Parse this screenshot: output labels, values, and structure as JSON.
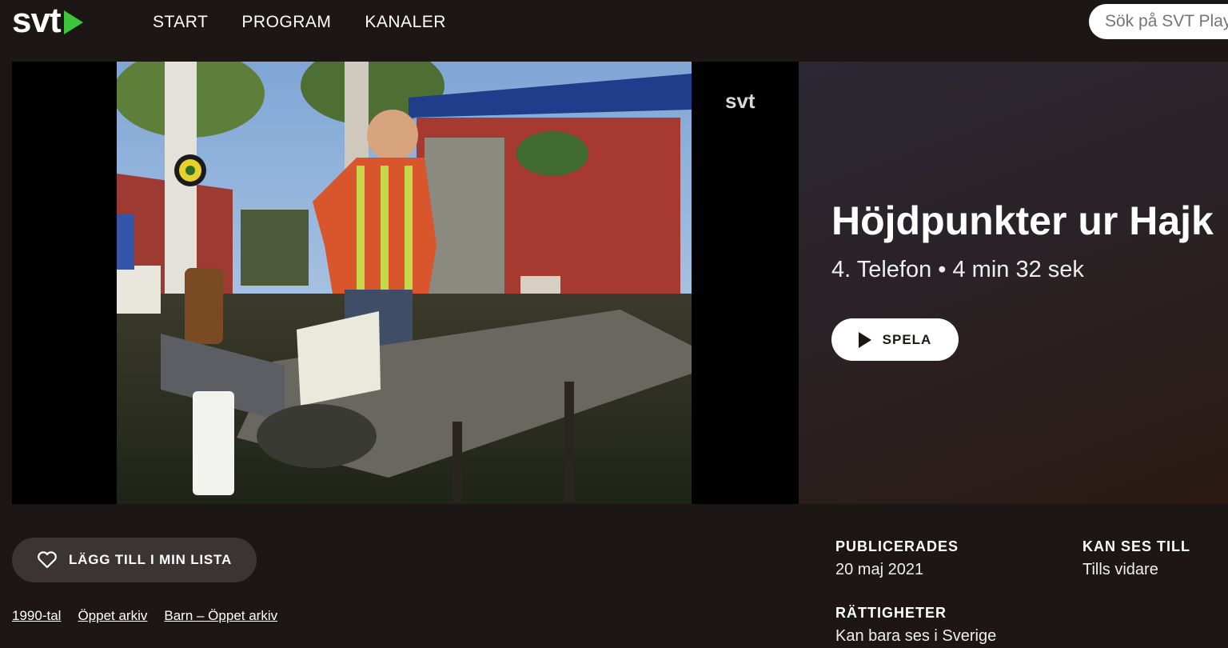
{
  "header": {
    "logo": "svt",
    "nav": [
      "START",
      "PROGRAM",
      "KANALER"
    ],
    "search_placeholder": "Sök på SVT Play"
  },
  "player": {
    "channel_bug": "svt",
    "title": "Höjdpunkter ur Hajk",
    "subtitle": "4. Telefon • 4 min 32 sek",
    "play_label": "SPELA"
  },
  "actions": {
    "add_to_list_label": "LÄGG TILL I MIN LISTA"
  },
  "tags": [
    "1990-tal",
    "Öppet arkiv",
    "Barn – Öppet arkiv"
  ],
  "meta": {
    "published_label": "PUBLICERADES",
    "published_value": "20 maj 2021",
    "available_label": "KAN SES TILL",
    "available_value": "Tills vidare",
    "rights_label": "RÄTTIGHETER",
    "rights_value": "Kan bara ses i Sverige"
  },
  "colors": {
    "background": "#1c1715",
    "accent_green": "#3ec53e",
    "button_dark": "#3a3533"
  },
  "icons": [
    "play-icon",
    "heart-icon",
    "svt-play-logo"
  ]
}
